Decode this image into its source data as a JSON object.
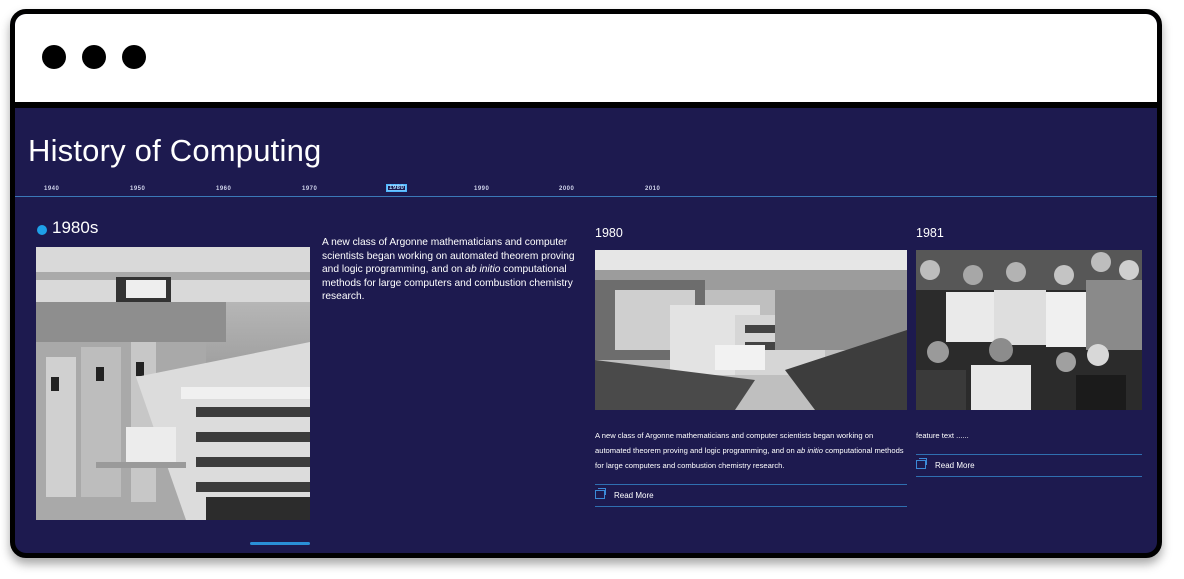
{
  "page": {
    "title": "History of Computing"
  },
  "timeline": {
    "decades": [
      "1940",
      "1950",
      "1960",
      "1970",
      "1980",
      "1990",
      "2000",
      "2010"
    ],
    "active": "1980"
  },
  "era": {
    "heading": "1980s",
    "lead_pre": "A new class of Argonne mathematicians and computer scientists began working on automated theorem proving and logic programming, and on ",
    "lead_em": "ab initio",
    "lead_post": " computational methods for large computers and combustion chemistry research."
  },
  "cards": [
    {
      "year": "1980",
      "desc_pre": "A new class of Argonne mathematicians and computer scientists began working on automated theorem proving and logic programming, and on ",
      "desc_em": "ab initio",
      "desc_post": " computational methods for large computers and combustion chemistry research.",
      "read_more": "Read More"
    },
    {
      "year": "1981",
      "desc_pre": "feature text ......",
      "desc_em": "",
      "desc_post": "",
      "read_more": "Read More"
    }
  ],
  "icons": {
    "read_more": "external-link-icon"
  },
  "colors": {
    "background": "#1d1a4f",
    "accent": "#1ea0e8"
  }
}
